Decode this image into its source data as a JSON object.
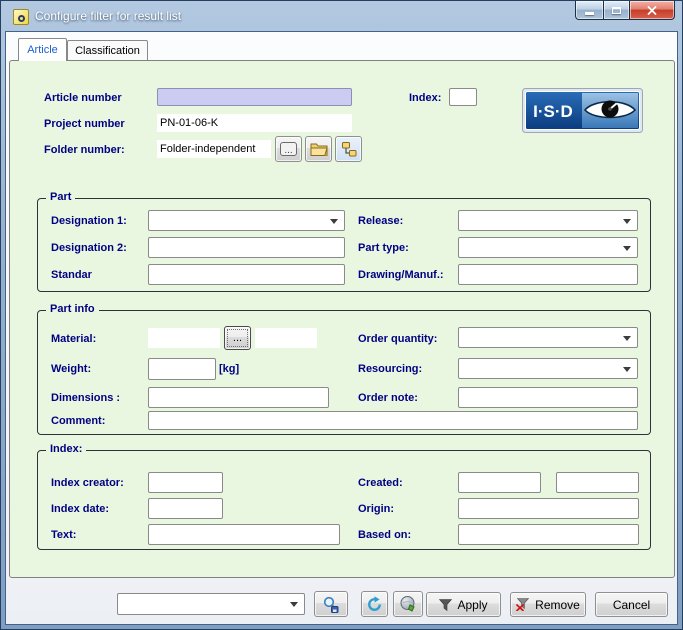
{
  "window": {
    "title": "Configure filter for result list"
  },
  "tabs": {
    "article": "Article",
    "classification": "Classification"
  },
  "header": {
    "article_number_label": "Article number",
    "article_number_value": "",
    "index_label": "Index:",
    "index_value": "",
    "project_number_label": "Project number",
    "project_number_value": "PN-01-06-K",
    "folder_number_label": "Folder number:",
    "folder_number_value": "Folder-independent",
    "browse_label": "...",
    "logo_text": "I·S·D"
  },
  "part": {
    "legend": "Part",
    "designation1_label": "Designation 1:",
    "designation1_value": "",
    "designation2_label": "Designation 2:",
    "designation2_value": "",
    "standard_label": "Standar",
    "standard_value": "",
    "release_label": "Release:",
    "release_value": "",
    "part_type_label": "Part type:",
    "part_type_value": "",
    "drawing_label": "Drawing/Manuf.:",
    "drawing_value": ""
  },
  "part_info": {
    "legend": "Part info",
    "material_label": "Material:",
    "material_value": "",
    "material_value2": "",
    "browse_label": "...",
    "weight_label": "Weight:",
    "weight_value": "",
    "weight_unit": "[kg]",
    "dimensions_label": "Dimensions :",
    "dimensions_value": "",
    "comment_label": "Comment:",
    "comment_value": "",
    "order_quantity_label": "Order quantity:",
    "order_quantity_value": "",
    "resourcing_label": "Resourcing:",
    "resourcing_value": "",
    "order_note_label": "Order note:",
    "order_note_value": ""
  },
  "index_section": {
    "legend": "Index:",
    "index_creator_label": "Index creator:",
    "index_creator_value": "",
    "index_date_label": "Index date:",
    "index_date_value": "",
    "text_label": "Text:",
    "text_value": "",
    "created_label": "Created:",
    "created_value1": "",
    "created_value2": "",
    "origin_label": "Origin:",
    "origin_value": "",
    "based_on_label": "Based on:",
    "based_on_value": ""
  },
  "footer": {
    "filter_value": "",
    "apply_label": "Apply",
    "remove_label": "Remove",
    "cancel_label": "Cancel"
  },
  "colors": {
    "page_green": "#eaf7e0",
    "label_navy": "#000084",
    "article_field_lavender": "#ccccf2",
    "logo_blue": "#0d4f9e",
    "titlebar_blue": "#91aecd"
  }
}
